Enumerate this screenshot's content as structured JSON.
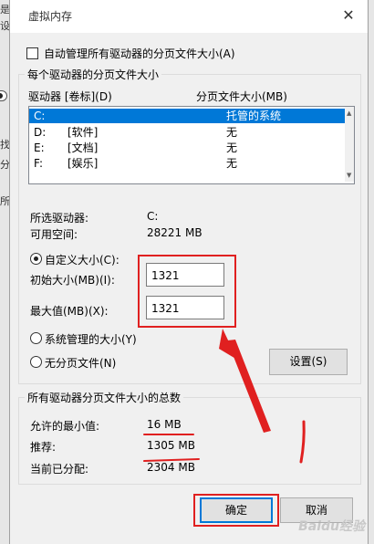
{
  "background": {
    "fragments": [
      "是",
      "设",
      "找",
      "分",
      "所"
    ]
  },
  "dialog": {
    "title": "虚拟内存",
    "close": "✕",
    "auto_manage_label": "自动管理所有驱动器的分页文件大小(A)",
    "drive_group_title": "每个驱动器的分页文件大小",
    "col_drive": "驱动器 [卷标](D)",
    "col_pagesize": "分页文件大小(MB)",
    "drives": [
      {
        "letter": "C:",
        "label": "",
        "size": "托管的系统"
      },
      {
        "letter": "D:",
        "label": "[软件]",
        "size": "无"
      },
      {
        "letter": "E:",
        "label": "[文档]",
        "size": "无"
      },
      {
        "letter": "F:",
        "label": "[娱乐]",
        "size": "无"
      }
    ],
    "selected_drive_label": "所选驱动器:",
    "selected_drive_value": "C:",
    "free_space_label": "可用空间:",
    "free_space_value": "28221 MB",
    "custom_size_label": "自定义大小(C):",
    "initial_size_label": "初始大小(MB)(I):",
    "initial_size_value": "1321",
    "max_size_label": "最大值(MB)(X):",
    "max_size_value": "1321",
    "system_managed_label": "系统管理的大小(Y)",
    "no_paging_label": "无分页文件(N)",
    "set_button": "设置(S)",
    "total_group_title": "所有驱动器分页文件大小的总数",
    "min_allowed_label": "允许的最小值:",
    "min_allowed_value": "16 MB",
    "recommended_label": "推荐:",
    "recommended_value": "1305 MB",
    "current_label": "当前已分配:",
    "current_value": "2304 MB",
    "ok_button": "确定",
    "cancel_button": "取消"
  },
  "watermark": "Baidu经验",
  "colors": {
    "selection": "#0078d7",
    "annotation": "#e02020"
  }
}
